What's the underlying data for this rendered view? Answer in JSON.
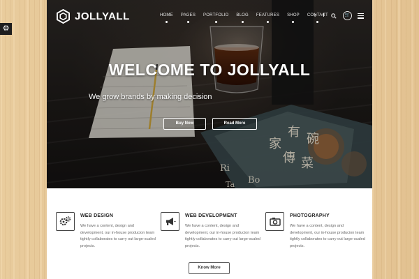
{
  "brand": {
    "name": "JOLLYALL"
  },
  "nav": {
    "items": [
      {
        "label": "HOME"
      },
      {
        "label": "PAGES"
      },
      {
        "label": "PORTFOLIO"
      },
      {
        "label": "BLOG"
      },
      {
        "label": "FEATURES"
      },
      {
        "label": "SHOP"
      },
      {
        "label": "CONTACT"
      }
    ],
    "icons": [
      "twitter-icon",
      "facebook-icon",
      "search-icon",
      "cart-icon",
      "menu-icon"
    ]
  },
  "hero": {
    "title": "WELCOME TO JOLLYALL",
    "subtitle": "We grow brands by making decision",
    "buttons": {
      "buy": "Buy Now",
      "read": "Read More"
    },
    "book_text": [
      "有",
      "碗",
      "家",
      "傳",
      "菜",
      "Ri",
      "Bo",
      "Ta"
    ]
  },
  "features": [
    {
      "icon": "gears-icon",
      "title": "WEB DESIGN",
      "text": "We have a content, design and development, our in-house producion team tightly collaborates to carry out large-scaled projects."
    },
    {
      "icon": "megaphone-icon",
      "title": "WEB DEVELOPMENT",
      "text": "We have a content, design and development, our in-house producion team tightly collaborates to carry out large-scaled projects."
    },
    {
      "icon": "camera-icon",
      "title": "PHOTOGRAPHY",
      "text": "We have a content, design and development, our in-house producion team tightly collaborates to carry out large-scaled projects."
    }
  ],
  "cta": {
    "know_more": "Know More"
  },
  "colors": {
    "accent": "#ffffff",
    "hero_dark": "#1d1a18",
    "wood": "#e6c89a"
  }
}
